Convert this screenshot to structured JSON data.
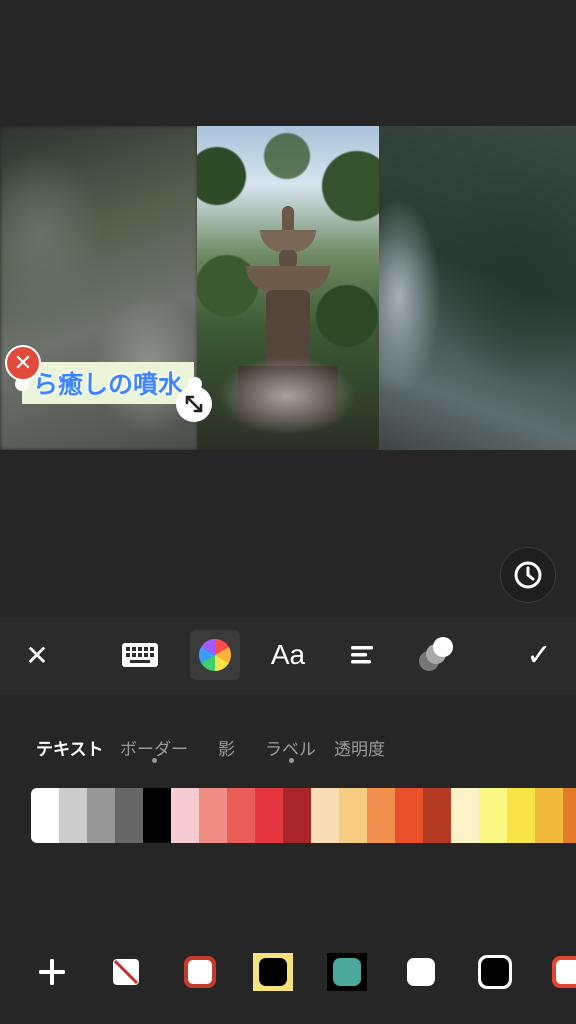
{
  "sticker": {
    "text": "ら癒しの噴水"
  },
  "toolbar": {
    "close": "✕",
    "font_label": "Aa",
    "confirm": "✓"
  },
  "tabs": [
    {
      "label": "テキスト",
      "selected": true
    },
    {
      "label": "ボーダー",
      "dot": true
    },
    {
      "label": "影"
    },
    {
      "label": "ラベル",
      "dot": true
    },
    {
      "label": "透明度"
    }
  ],
  "palette": [
    "#ffffff",
    "#cccccc",
    "#999999",
    "#666666",
    "#000000",
    "#f7ccd1",
    "#f08e86",
    "#e85d58",
    "#e5353f",
    "#a8262a",
    "#f8dcb6",
    "#f5cc80",
    "#f0904c",
    "#e8522a",
    "#b53a22",
    "#fbf3c7",
    "#faf782",
    "#f7e447",
    "#f1b93a",
    "#e67a2b"
  ],
  "bottom_icons": [
    "add-icon",
    "no-style-icon",
    "red-border-style-icon",
    "yellow-label-style-icon",
    "teal-label-style-icon",
    "white-fill-style-icon",
    "black-outline-style-icon",
    "red-outline-style-icon"
  ]
}
